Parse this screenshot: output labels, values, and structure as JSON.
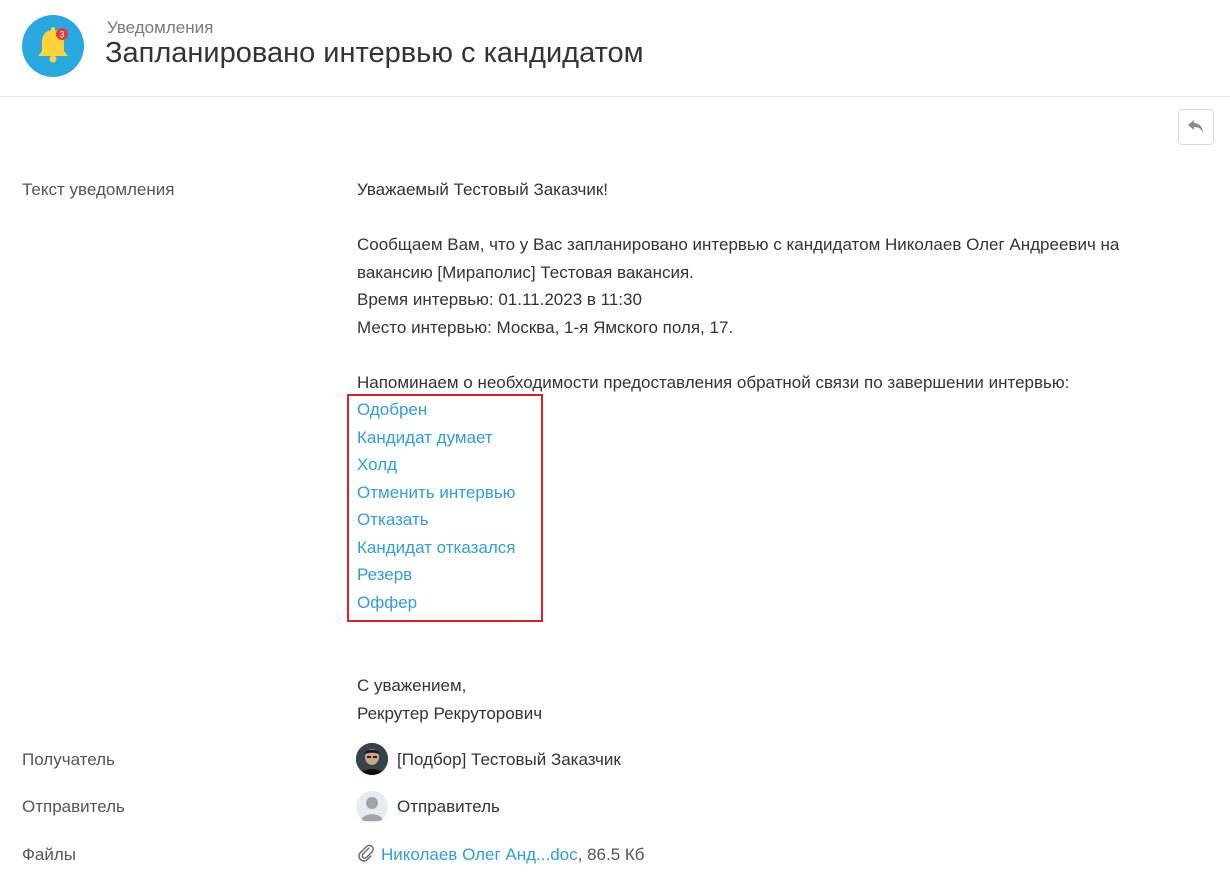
{
  "header": {
    "section": "Уведомления",
    "title": "Запланировано интервью с кандидатом",
    "badge_count": "3",
    "accent_color": "#29a8e0",
    "icon": "bell-icon"
  },
  "toolbar": {
    "reply_icon": "reply-icon"
  },
  "fields": {
    "text_label": "Текст уведомления",
    "recipient_label": "Получатель",
    "sender_label": "Отправитель",
    "files_label": "Файлы"
  },
  "message": {
    "greeting": "Уважаемый Тестовый Заказчик!",
    "line1": "Сообщаем Вам, что у Вас запланировано интервью с кандидатом Николаев Олег Андреевич на",
    "line2": "вакансию [Мираполис] Тестовая вакансия.",
    "line3": "Время интервью: 01.11.2023 в 11:30",
    "line4": "Место интервью: Москва, 1-я Ямского поля, 17.",
    "reminder": "Напоминаем о необходимости предоставления обратной связи по завершении интервью:",
    "actions": [
      "Одобрен",
      "Кандидат думает",
      "Холд",
      "Отменить интервью",
      "Отказать",
      "Кандидат отказался",
      "Резерв",
      "Оффер"
    ],
    "closing": "С уважением,",
    "signature": "Рекрутер Рекруторович"
  },
  "recipient": {
    "name": "[Подбор] Тестовый Заказчик"
  },
  "sender": {
    "name": "Отправитель"
  },
  "file": {
    "name": "Николаев Олег Анд...doc",
    "size": ", 86.5 Кб"
  },
  "colors": {
    "link": "#2e9fd8",
    "highlight_border": "#e21e26"
  }
}
